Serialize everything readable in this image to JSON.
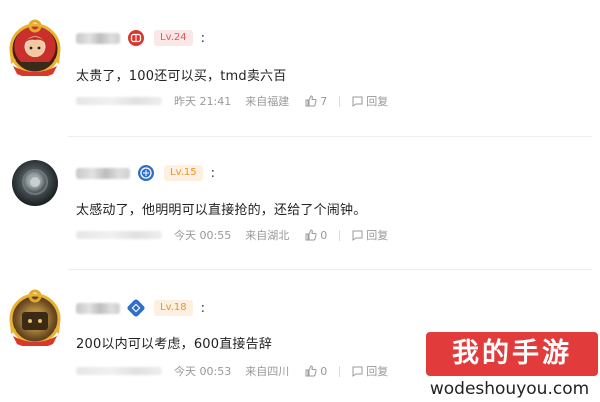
{
  "comments": [
    {
      "level": "Lv.24",
      "text": "太贵了，100还可以买，tmd卖六百",
      "time": "昨天 21:41",
      "location": "来自福建",
      "likes": "7",
      "reply_label": "回复",
      "badge_icon": "game-console-icon",
      "level_color": "#e05a5a"
    },
    {
      "level": "Lv.15",
      "text": "太感动了，他明明可以直接抢的，还给了个闹钟。",
      "time": "今天 00:55",
      "location": "来自湖北",
      "likes": "0",
      "reply_label": "回复",
      "badge_icon": "blue-emblem-icon",
      "level_color": "#e8932c"
    },
    {
      "level": "Lv.18",
      "text": "200以内可以考虑，600直接告辞",
      "time": "今天 00:53",
      "location": "来自四川",
      "likes": "0",
      "reply_label": "回复",
      "badge_icon": "blue-cube-icon",
      "level_color": "#e8932c"
    }
  ],
  "colon": ":",
  "watermark": {
    "title": "我的手游",
    "url": "wodeshouyou.com"
  }
}
